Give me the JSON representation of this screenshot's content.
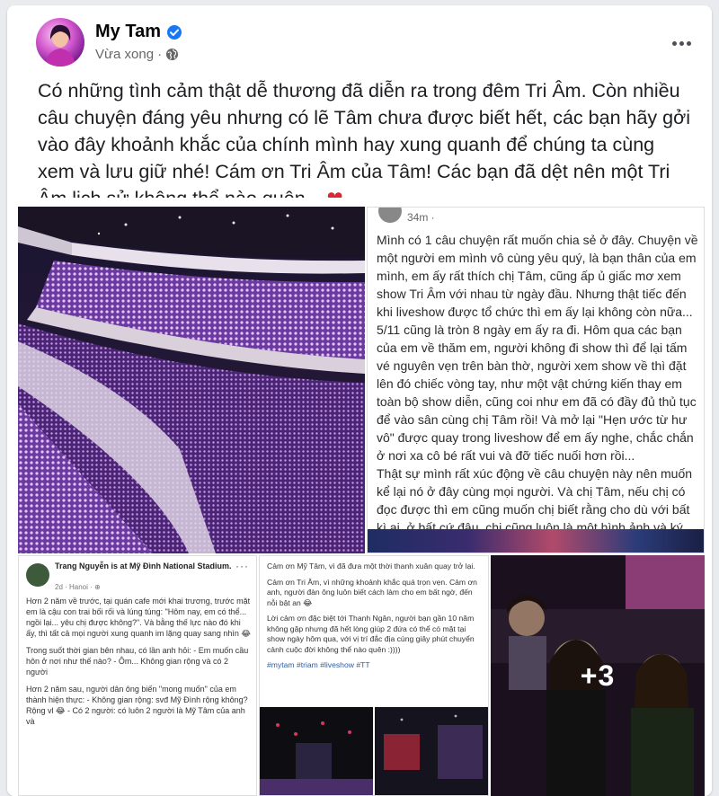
{
  "author": {
    "name": "My Tam",
    "time": "Vừa xong",
    "audience_icon": "globe-icon",
    "verified_icon": "verified-badge-icon"
  },
  "post": {
    "caption": "Có những tình cảm thật dễ thương đã diễn ra trong đêm Tri Âm. Còn nhiều câu chuyện đáng yêu nhưng có lẽ Tâm chưa được biết hết, các bạn hãy gởi vào đây khoảnh khắc của chính mình hay xung quanh để chúng ta cùng xem và lưu giữ nhé! Cám ơn Tri Âm của Tâm! Các bạn đã dệt nên một Tri Âm lịch sử không thể nào quên...",
    "caption_emoji": "❤"
  },
  "media": {
    "more_count": "+3",
    "story_screenshot": {
      "time": "34m ·",
      "paragraphs": [
        "Mình có 1 câu chuyện rất muốn chia sẻ ở đây. Chuyện về một người em mình vô cùng yêu quý, là bạn thân của em mình, em ấy rất thích chị Tâm, cũng ấp ủ giấc mơ xem show Tri Âm với nhau từ ngày đầu. Nhưng thật tiếc đến khi liveshow được tổ chức thì em ấy lại không còn nữa... 5/11 cũng là tròn 8 ngày em ấy ra đi. Hôm qua các bạn của em về thăm em, người không đi show thì để lại tấm vé nguyên vẹn trên bàn thờ, người xem show về thì đặt lên đó chiếc vòng tay, như một vật chứng kiến thay em toàn bộ show diễn, cũng coi như em đã có đầy đủ thủ tục để vào sân cùng chị Tâm rồi! Và mở lại \"Hẹn ước từ hư vô\" được quay trong liveshow để em ấy nghe, chắc chắn ở nơi xa cô bé rất vui và đỡ tiếc nuối hơn rồi...",
        "Thật sự mình rất xúc động về câu chuyện này nên muốn kể lại nó ở đây cùng mọi người. Và chị Tâm, nếu chị có đọc được thì em cũng muốn chị biết rằng cho dù với bất kì ai, ở bất cứ đâu, chị cũng luôn là một hình ảnh và ký ức rất đẹp mà mọi người đều muốn lưu lại mãi trong tim ❤️"
      ]
    },
    "checkin_screenshot": {
      "name": "Trang Nguyễn is at Mỹ Đình National Stadium.",
      "meta": "2d · Hanoi · ⊕",
      "paragraphs": [
        "Hơn 2 năm về trước, tại quán cafe mới khai trương, trước mặt em là cậu con trai bối rối và lúng túng: \"Hôm nay, em có thể... ngồi lại... yêu chị được không?\". Và bằng thế lực nào đó khi ấy, thì tất cả mọi người xung quanh im lặng quay sang nhìn 😂",
        "Trong suốt thời gian bên nhau, có lần anh hỏi: - Em muốn cầu hôn ở nơi như thế nào? - Ôm... Không gian rộng và có 2 người",
        "Hơn 2 năm sau, người dân ông biến \"mong muốn\" của em thành hiện thực: - Không gian rộng: svđ Mỹ Đình rộng không? Rộng vl 😂 - Có 2 người: có luôn 2 người là Mỹ Tâm của anh và"
      ]
    },
    "thanks_screenshot": {
      "paragraphs": [
        "Cảm ơn Mỹ Tâm, vì đã đưa một thời thanh xuân quay trở lại.",
        "Cảm ơn Tri Âm, vì những khoảnh khắc quá trọn vẹn. Cảm ơn anh, người đàn ông luôn biết cách làm cho em bất ngờ, đến nỗi bật an 😂",
        "Lời cảm ơn đặc biệt tới Thanh Ngân, người bạn gần 10 năm không gặp nhưng đã hết lòng giúp 2 đứa có thể có mặt tại show ngày hôm qua, với vị trí đắc địa cùng giây phút chuyển cảnh cuộc đời không thể nào quên :))))"
      ],
      "tags": "#mytam #triam #liveshow #TT"
    }
  },
  "colors": {
    "name": "#050505",
    "meta": "#65676b",
    "verified": "#1877f2",
    "heart": "#e0262f"
  }
}
